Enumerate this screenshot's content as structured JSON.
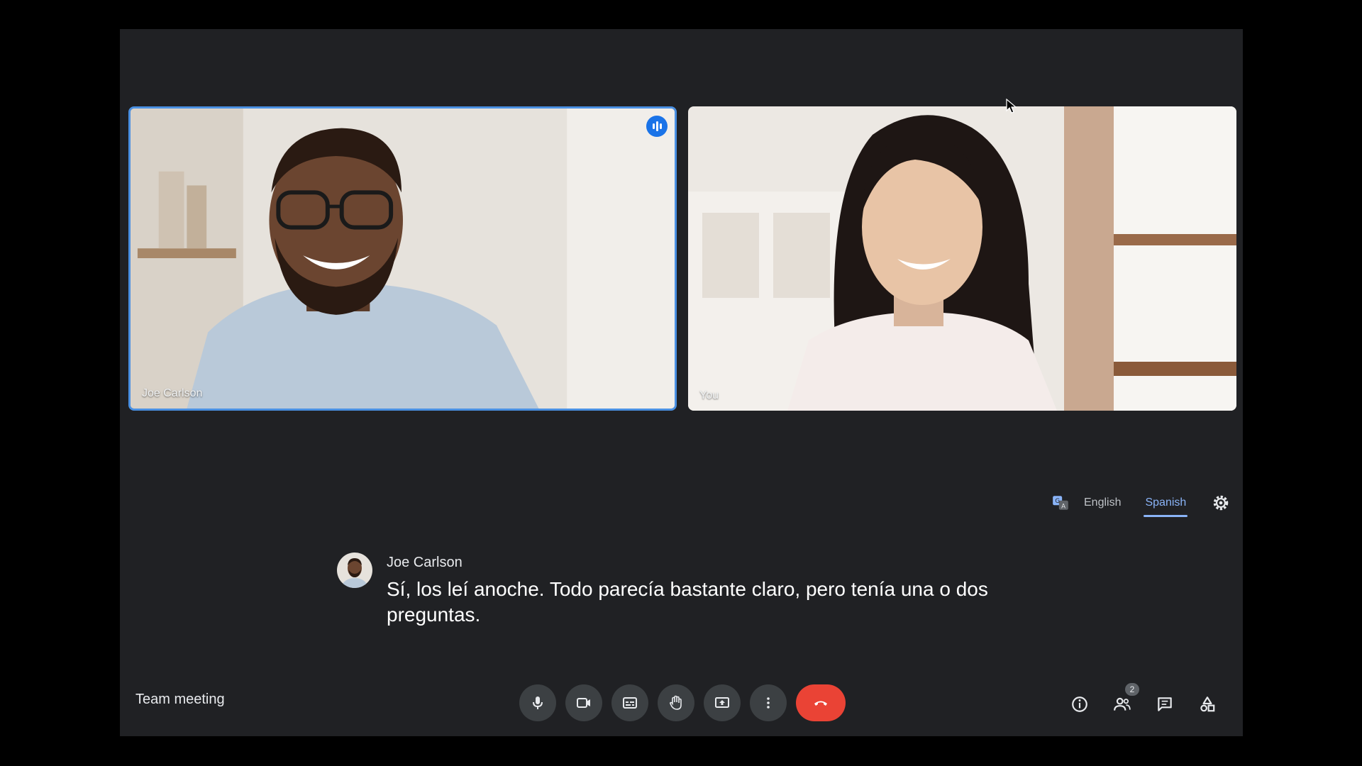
{
  "meeting": {
    "title": "Team meeting"
  },
  "participants": [
    {
      "name": "Joe Carlson",
      "speaking": true
    },
    {
      "name": "You",
      "speaking": false
    }
  ],
  "captions": {
    "languages": [
      "English",
      "Spanish"
    ],
    "active_language": "Spanish",
    "speaker": "Joe Carlson",
    "text": "Sí, los leí anoche. Todo parecía bastante claro, pero tenía una o dos preguntas."
  },
  "toolbar": {
    "controls": [
      "mic-icon",
      "camera-icon",
      "captions-icon",
      "raise-hand-icon",
      "present-icon",
      "more-options-icon",
      "end-call-icon"
    ],
    "right": {
      "participant_count": "2",
      "icons": [
        "info-icon",
        "people-icon",
        "chat-icon",
        "activities-icon"
      ]
    }
  },
  "colors": {
    "background": "#202124",
    "accent": "#8ab4f8",
    "end_call": "#ea4335",
    "active_speaker_border": "#4a90e2"
  }
}
